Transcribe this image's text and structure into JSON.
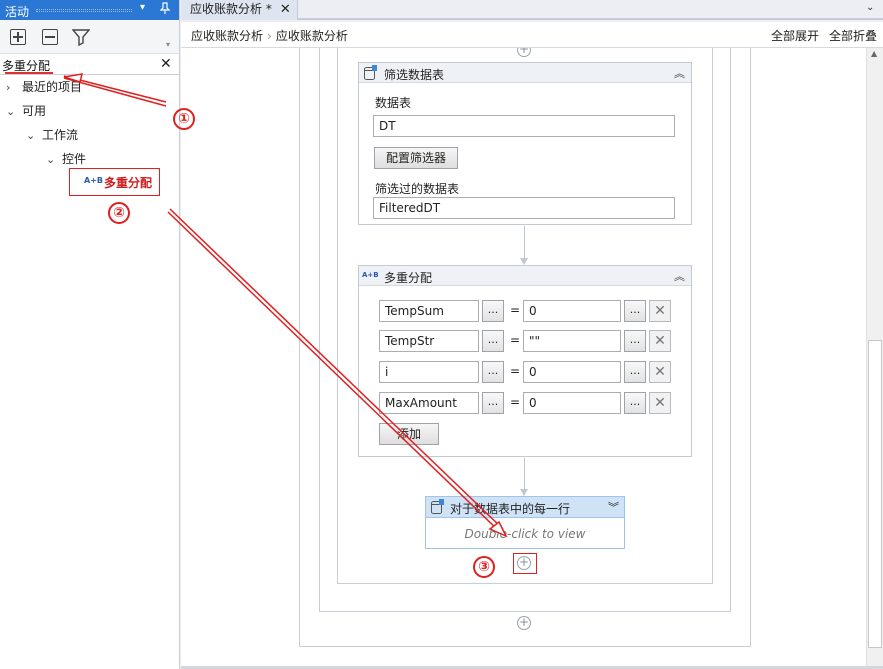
{
  "panel": {
    "title": "活动",
    "dropdown_glyph": "▾",
    "pin_glyph": "📌",
    "toolbar_icons": [
      "expand-all-icon",
      "collapse-all-icon",
      "filter-icon"
    ],
    "search_value": "多重分配",
    "search_clear": "✕",
    "tree": [
      {
        "label": "最近的项目",
        "chevron": "›"
      },
      {
        "label": "可用",
        "chevron": "⌄"
      },
      {
        "label": "工作流",
        "chevron": "⌄"
      },
      {
        "label": "控件",
        "chevron": "⌄"
      }
    ],
    "match": {
      "icon_text": "A+B",
      "label": "多重分配"
    }
  },
  "tab": {
    "label": "应收账款分析 *",
    "close": "✕",
    "overflow": "⌄"
  },
  "breadcrumb": {
    "items": [
      "应收账款分析",
      "应收账款分析"
    ],
    "separator": "›"
  },
  "toolbar": {
    "expand_all": "全部展开",
    "collapse_all": "全部折叠"
  },
  "filter_activity": {
    "title": "筛选数据表",
    "collapse_glyph": "︽",
    "data_table_label": "数据表",
    "data_table_value": "DT",
    "configure_button": "配置筛选器",
    "filtered_label": "筛选过的数据表",
    "filtered_value": "FilteredDT"
  },
  "multi_assign": {
    "title": "多重分配",
    "icon_text": "A+B",
    "collapse_glyph": "︽",
    "rows": [
      {
        "to": "TempSum",
        "value": "0"
      },
      {
        "to": "TempStr",
        "value": "\"\""
      },
      {
        "to": "i",
        "value": "0"
      },
      {
        "to": "MaxAmount",
        "value": "0"
      }
    ],
    "dots": "...",
    "equals": "=",
    "remove": "✕",
    "add_button": "添加"
  },
  "foreach_activity": {
    "title": "对于数据表中的每一行",
    "collapse_glyph": "︾",
    "hint": "Double-click to view"
  },
  "plus_glyph": "+",
  "annotations": {
    "one": "①",
    "two": "②",
    "three": "③",
    "color": "#e02020"
  }
}
